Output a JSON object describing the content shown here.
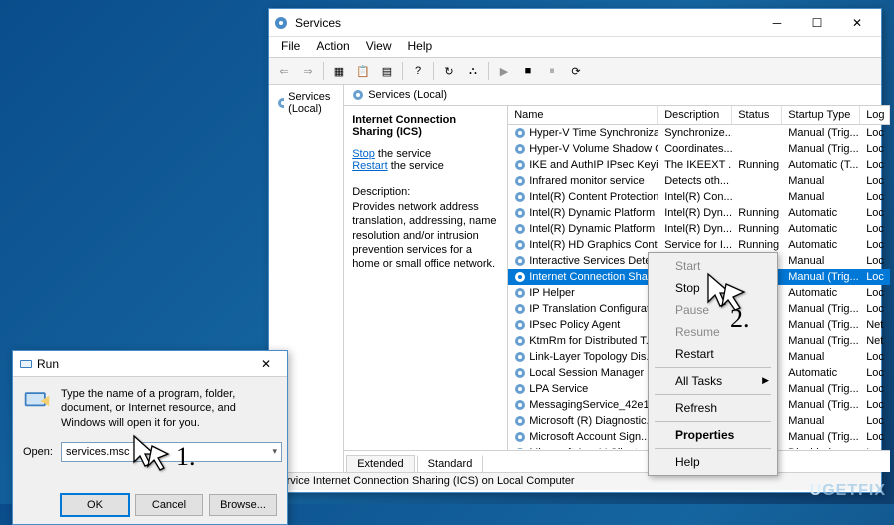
{
  "services_window": {
    "title": "Services",
    "menu": [
      "File",
      "Action",
      "View",
      "Help"
    ],
    "left_tree": "Services (Local)",
    "right_header": "Services (Local)",
    "selected": {
      "name": "Internet Connection Sharing (ICS)",
      "stop_link": "Stop",
      "stop_suffix": " the service",
      "restart_link": "Restart",
      "restart_suffix": " the service",
      "desc_label": "Description:",
      "desc_text": "Provides network address translation, addressing, name resolution and/or intrusion prevention services for a home or small office network."
    },
    "columns": [
      "Name",
      "Description",
      "Status",
      "Startup Type",
      "Log"
    ],
    "rows": [
      {
        "name": "Hyper-V Time Synchronizat...",
        "desc": "Synchronize...",
        "status": "",
        "startup": "Manual (Trig...",
        "log": "Loc"
      },
      {
        "name": "Hyper-V Volume Shadow C...",
        "desc": "Coordinates...",
        "status": "",
        "startup": "Manual (Trig...",
        "log": "Loc"
      },
      {
        "name": "IKE and AuthIP IPsec Keying...",
        "desc": "The IKEEXT ...",
        "status": "Running",
        "startup": "Automatic (T...",
        "log": "Loc"
      },
      {
        "name": "Infrared monitor service",
        "desc": "Detects oth...",
        "status": "",
        "startup": "Manual",
        "log": "Loc"
      },
      {
        "name": "Intel(R) Content Protection ...",
        "desc": "Intel(R) Con...",
        "status": "",
        "startup": "Manual",
        "log": "Loc"
      },
      {
        "name": "Intel(R) Dynamic Platform a...",
        "desc": "Intel(R) Dyn...",
        "status": "Running",
        "startup": "Automatic",
        "log": "Loc"
      },
      {
        "name": "Intel(R) Dynamic Platform a...",
        "desc": "Intel(R) Dyn...",
        "status": "Running",
        "startup": "Automatic",
        "log": "Loc"
      },
      {
        "name": "Intel(R) HD Graphics Contro...",
        "desc": "Service for I...",
        "status": "Running",
        "startup": "Automatic",
        "log": "Loc"
      },
      {
        "name": "Interactive Services Detection",
        "desc": "Enables use...",
        "status": "",
        "startup": "Manual",
        "log": "Loc"
      },
      {
        "name": "Internet Connection Shari...",
        "desc": "",
        "status": "",
        "startup": "Manual (Trig...",
        "log": "Loc",
        "selected": true
      },
      {
        "name": "IP Helper",
        "desc": "",
        "status": "",
        "startup": "Automatic",
        "log": "Loc"
      },
      {
        "name": "IP Translation Configurat...",
        "desc": "",
        "status": "",
        "startup": "Manual (Trig...",
        "log": "Loc"
      },
      {
        "name": "IPsec Policy Agent",
        "desc": "",
        "status": "",
        "startup": "Manual (Trig...",
        "log": "Net"
      },
      {
        "name": "KtmRm for Distributed T...",
        "desc": "",
        "status": "",
        "startup": "Manual (Trig...",
        "log": "Net"
      },
      {
        "name": "Link-Layer Topology Dis...",
        "desc": "",
        "status": "",
        "startup": "Manual",
        "log": "Loc"
      },
      {
        "name": "Local Session Manager",
        "desc": "",
        "status": "",
        "startup": "Automatic",
        "log": "Loc"
      },
      {
        "name": "LPA Service",
        "desc": "",
        "status": "",
        "startup": "Manual (Trig...",
        "log": "Loc"
      },
      {
        "name": "MessagingService_42e10...",
        "desc": "",
        "status": "",
        "startup": "Manual (Trig...",
        "log": "Loc"
      },
      {
        "name": "Microsoft (R) Diagnostic...",
        "desc": "",
        "status": "",
        "startup": "Manual",
        "log": "Loc"
      },
      {
        "name": "Microsoft Account Sign...",
        "desc": "",
        "status": "",
        "startup": "Manual (Trig...",
        "log": "Loc"
      },
      {
        "name": "Microsoft App-V Client",
        "desc": "",
        "status": "",
        "startup": "Disabled",
        "log": "Loc"
      }
    ],
    "tabs": [
      "Extended",
      "Standard"
    ],
    "statusbar": "service Internet Connection Sharing (ICS) on Local Computer"
  },
  "context_menu": {
    "items": [
      {
        "label": "Start",
        "disabled": true
      },
      {
        "label": "Stop"
      },
      {
        "label": "Pause",
        "disabled": true
      },
      {
        "label": "Resume",
        "disabled": true
      },
      {
        "label": "Restart"
      },
      {
        "sep": true
      },
      {
        "label": "All Tasks",
        "submenu": true
      },
      {
        "sep": true
      },
      {
        "label": "Refresh"
      },
      {
        "sep": true
      },
      {
        "label": "Properties",
        "bold": true
      },
      {
        "sep": true
      },
      {
        "label": "Help"
      }
    ]
  },
  "run_dialog": {
    "title": "Run",
    "desc": "Type the name of a program, folder, document, or Internet resource, and Windows will open it for you.",
    "open_label": "Open:",
    "input_value": "services.msc",
    "ok": "OK",
    "cancel": "Cancel",
    "browse": "Browse..."
  },
  "steps": {
    "one": "1.",
    "two": "2."
  },
  "watermark": "UGETFIX"
}
